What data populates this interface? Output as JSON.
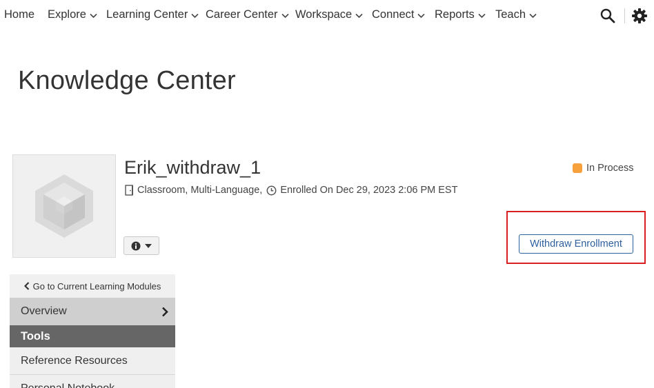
{
  "nav": {
    "items": [
      {
        "label": "Home",
        "dropdown": false
      },
      {
        "label": "Explore",
        "dropdown": true
      },
      {
        "label": "Learning Center",
        "dropdown": true
      },
      {
        "label": "Career Center",
        "dropdown": true
      },
      {
        "label": "Workspace",
        "dropdown": true
      },
      {
        "label": "Connect",
        "dropdown": true
      },
      {
        "label": "Reports",
        "dropdown": true
      },
      {
        "label": "Teach",
        "dropdown": true
      }
    ],
    "search_icon": "search-icon",
    "settings_icon": "gear-icon"
  },
  "page": {
    "title": "Knowledge Center"
  },
  "course": {
    "title": "Erik_withdraw_1",
    "type": "Classroom, Multi-Language,",
    "enrolled": "Enrolled On Dec 29, 2023 2:06 PM EST",
    "status": "In Process",
    "status_color": "#f7a13c",
    "withdraw_label": "Withdraw Enrollment",
    "thumbnail_icon": "cube-placeholder-icon",
    "info_icon": "info-circle-icon"
  },
  "sidebar": {
    "back_label": "Go to Current Learning Modules",
    "overview_label": "Overview",
    "tools_header": "Tools",
    "reference_label": "Reference Resources",
    "notebook_label": "Personal Notebook"
  },
  "colors": {
    "accent": "#2c5f9e",
    "highlight": "#d81e1e",
    "tools_header_bg": "#666666"
  }
}
